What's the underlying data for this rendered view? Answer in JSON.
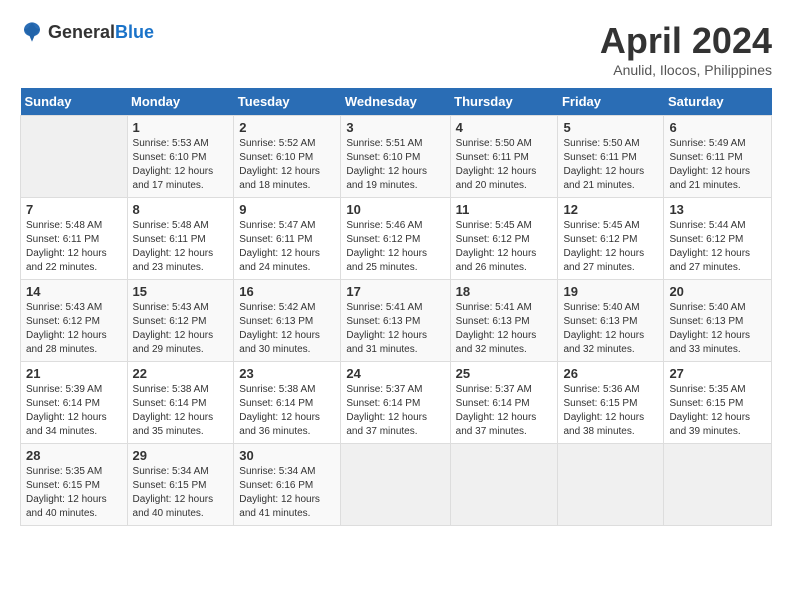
{
  "header": {
    "logo_general": "General",
    "logo_blue": "Blue",
    "month_title": "April 2024",
    "subtitle": "Anulid, Ilocos, Philippines"
  },
  "days_of_week": [
    "Sunday",
    "Monday",
    "Tuesday",
    "Wednesday",
    "Thursday",
    "Friday",
    "Saturday"
  ],
  "weeks": [
    [
      {
        "day": "",
        "sunrise": "",
        "sunset": "",
        "daylight": ""
      },
      {
        "day": "1",
        "sunrise": "Sunrise: 5:53 AM",
        "sunset": "Sunset: 6:10 PM",
        "daylight": "Daylight: 12 hours and 17 minutes."
      },
      {
        "day": "2",
        "sunrise": "Sunrise: 5:52 AM",
        "sunset": "Sunset: 6:10 PM",
        "daylight": "Daylight: 12 hours and 18 minutes."
      },
      {
        "day": "3",
        "sunrise": "Sunrise: 5:51 AM",
        "sunset": "Sunset: 6:10 PM",
        "daylight": "Daylight: 12 hours and 19 minutes."
      },
      {
        "day": "4",
        "sunrise": "Sunrise: 5:50 AM",
        "sunset": "Sunset: 6:11 PM",
        "daylight": "Daylight: 12 hours and 20 minutes."
      },
      {
        "day": "5",
        "sunrise": "Sunrise: 5:50 AM",
        "sunset": "Sunset: 6:11 PM",
        "daylight": "Daylight: 12 hours and 21 minutes."
      },
      {
        "day": "6",
        "sunrise": "Sunrise: 5:49 AM",
        "sunset": "Sunset: 6:11 PM",
        "daylight": "Daylight: 12 hours and 21 minutes."
      }
    ],
    [
      {
        "day": "7",
        "sunrise": "Sunrise: 5:48 AM",
        "sunset": "Sunset: 6:11 PM",
        "daylight": "Daylight: 12 hours and 22 minutes."
      },
      {
        "day": "8",
        "sunrise": "Sunrise: 5:48 AM",
        "sunset": "Sunset: 6:11 PM",
        "daylight": "Daylight: 12 hours and 23 minutes."
      },
      {
        "day": "9",
        "sunrise": "Sunrise: 5:47 AM",
        "sunset": "Sunset: 6:11 PM",
        "daylight": "Daylight: 12 hours and 24 minutes."
      },
      {
        "day": "10",
        "sunrise": "Sunrise: 5:46 AM",
        "sunset": "Sunset: 6:12 PM",
        "daylight": "Daylight: 12 hours and 25 minutes."
      },
      {
        "day": "11",
        "sunrise": "Sunrise: 5:45 AM",
        "sunset": "Sunset: 6:12 PM",
        "daylight": "Daylight: 12 hours and 26 minutes."
      },
      {
        "day": "12",
        "sunrise": "Sunrise: 5:45 AM",
        "sunset": "Sunset: 6:12 PM",
        "daylight": "Daylight: 12 hours and 27 minutes."
      },
      {
        "day": "13",
        "sunrise": "Sunrise: 5:44 AM",
        "sunset": "Sunset: 6:12 PM",
        "daylight": "Daylight: 12 hours and 27 minutes."
      }
    ],
    [
      {
        "day": "14",
        "sunrise": "Sunrise: 5:43 AM",
        "sunset": "Sunset: 6:12 PM",
        "daylight": "Daylight: 12 hours and 28 minutes."
      },
      {
        "day": "15",
        "sunrise": "Sunrise: 5:43 AM",
        "sunset": "Sunset: 6:12 PM",
        "daylight": "Daylight: 12 hours and 29 minutes."
      },
      {
        "day": "16",
        "sunrise": "Sunrise: 5:42 AM",
        "sunset": "Sunset: 6:13 PM",
        "daylight": "Daylight: 12 hours and 30 minutes."
      },
      {
        "day": "17",
        "sunrise": "Sunrise: 5:41 AM",
        "sunset": "Sunset: 6:13 PM",
        "daylight": "Daylight: 12 hours and 31 minutes."
      },
      {
        "day": "18",
        "sunrise": "Sunrise: 5:41 AM",
        "sunset": "Sunset: 6:13 PM",
        "daylight": "Daylight: 12 hours and 32 minutes."
      },
      {
        "day": "19",
        "sunrise": "Sunrise: 5:40 AM",
        "sunset": "Sunset: 6:13 PM",
        "daylight": "Daylight: 12 hours and 32 minutes."
      },
      {
        "day": "20",
        "sunrise": "Sunrise: 5:40 AM",
        "sunset": "Sunset: 6:13 PM",
        "daylight": "Daylight: 12 hours and 33 minutes."
      }
    ],
    [
      {
        "day": "21",
        "sunrise": "Sunrise: 5:39 AM",
        "sunset": "Sunset: 6:14 PM",
        "daylight": "Daylight: 12 hours and 34 minutes."
      },
      {
        "day": "22",
        "sunrise": "Sunrise: 5:38 AM",
        "sunset": "Sunset: 6:14 PM",
        "daylight": "Daylight: 12 hours and 35 minutes."
      },
      {
        "day": "23",
        "sunrise": "Sunrise: 5:38 AM",
        "sunset": "Sunset: 6:14 PM",
        "daylight": "Daylight: 12 hours and 36 minutes."
      },
      {
        "day": "24",
        "sunrise": "Sunrise: 5:37 AM",
        "sunset": "Sunset: 6:14 PM",
        "daylight": "Daylight: 12 hours and 37 minutes."
      },
      {
        "day": "25",
        "sunrise": "Sunrise: 5:37 AM",
        "sunset": "Sunset: 6:14 PM",
        "daylight": "Daylight: 12 hours and 37 minutes."
      },
      {
        "day": "26",
        "sunrise": "Sunrise: 5:36 AM",
        "sunset": "Sunset: 6:15 PM",
        "daylight": "Daylight: 12 hours and 38 minutes."
      },
      {
        "day": "27",
        "sunrise": "Sunrise: 5:35 AM",
        "sunset": "Sunset: 6:15 PM",
        "daylight": "Daylight: 12 hours and 39 minutes."
      }
    ],
    [
      {
        "day": "28",
        "sunrise": "Sunrise: 5:35 AM",
        "sunset": "Sunset: 6:15 PM",
        "daylight": "Daylight: 12 hours and 40 minutes."
      },
      {
        "day": "29",
        "sunrise": "Sunrise: 5:34 AM",
        "sunset": "Sunset: 6:15 PM",
        "daylight": "Daylight: 12 hours and 40 minutes."
      },
      {
        "day": "30",
        "sunrise": "Sunrise: 5:34 AM",
        "sunset": "Sunset: 6:16 PM",
        "daylight": "Daylight: 12 hours and 41 minutes."
      },
      {
        "day": "",
        "sunrise": "",
        "sunset": "",
        "daylight": ""
      },
      {
        "day": "",
        "sunrise": "",
        "sunset": "",
        "daylight": ""
      },
      {
        "day": "",
        "sunrise": "",
        "sunset": "",
        "daylight": ""
      },
      {
        "day": "",
        "sunrise": "",
        "sunset": "",
        "daylight": ""
      }
    ]
  ]
}
